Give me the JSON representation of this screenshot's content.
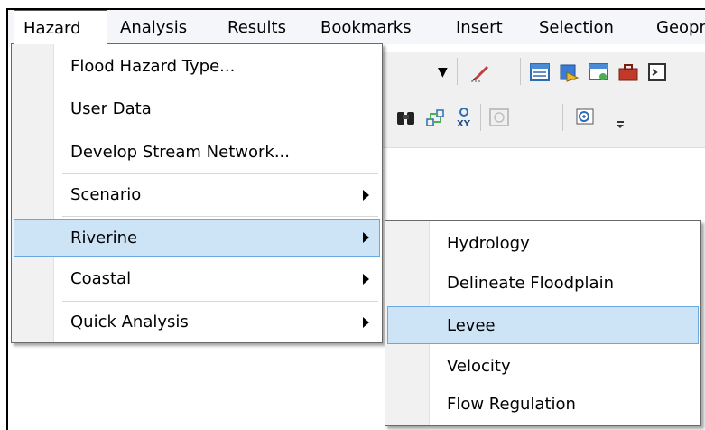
{
  "menubar": {
    "items": [
      "Hazard",
      "Analysis",
      "Results",
      "Bookmarks",
      "Insert",
      "Selection",
      "Geopr"
    ]
  },
  "toolbar": {
    "icons": [
      "pencil-icon",
      "table-icon",
      "layer-icon",
      "window-icon",
      "toolbox-icon",
      "binoculars-icon",
      "graph-icon",
      "goto-xy-icon",
      "time-slider-icon",
      "magnifier-icon"
    ]
  },
  "hazard_menu": {
    "items": [
      {
        "label": "Flood Hazard Type...",
        "submenu": false
      },
      {
        "label": "User Data",
        "submenu": false
      },
      {
        "label": "Develop Stream Network...",
        "submenu": false
      },
      {
        "label": "Scenario",
        "submenu": true
      },
      {
        "label": "Riverine",
        "submenu": true,
        "highlighted": true
      },
      {
        "label": "Coastal",
        "submenu": true
      },
      {
        "label": "Quick Analysis",
        "submenu": true
      }
    ]
  },
  "riverine_submenu": {
    "items": [
      {
        "label": "Hydrology"
      },
      {
        "label": "Delineate Floodplain"
      },
      {
        "label": "Levee",
        "highlighted": true
      },
      {
        "label": "Velocity"
      },
      {
        "label": "Flow Regulation"
      }
    ]
  },
  "colors": {
    "highlight": "#cde4f7",
    "highlight_border": "#6aa8e2",
    "menubar_bg": "#f4f6fa"
  }
}
